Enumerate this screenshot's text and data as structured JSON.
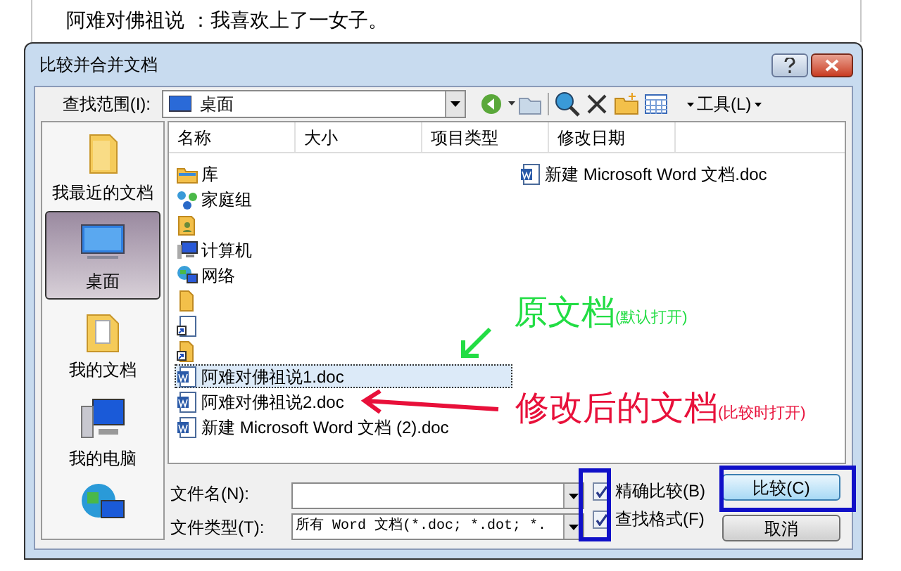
{
  "document": {
    "text": "阿难对佛祖说 ：我喜欢上了一女子。"
  },
  "window": {
    "title": "比较并合并文档"
  },
  "look_in": {
    "label": "查找范围(I):",
    "value": "桌面"
  },
  "tools_menu": {
    "label": "工具(L)"
  },
  "sidebar": {
    "items": [
      {
        "label": "我最近的文档",
        "kind": "recent",
        "selected": false
      },
      {
        "label": "桌面",
        "kind": "desktop",
        "selected": true
      },
      {
        "label": "我的文档",
        "kind": "documents",
        "selected": false
      },
      {
        "label": "我的电脑",
        "kind": "computer",
        "selected": false
      },
      {
        "kind": "network",
        "selected": false
      }
    ]
  },
  "table": {
    "columns": [
      "名称",
      "大小",
      "项目类型",
      "修改日期"
    ]
  },
  "files": [
    {
      "label": "库",
      "kind": "library",
      "selected": false
    },
    {
      "label": "家庭组",
      "kind": "homegroup",
      "selected": false
    },
    {
      "kind": "user-folder",
      "selected": false
    },
    {
      "label": "计算机",
      "kind": "computer",
      "selected": false
    },
    {
      "label": "网络",
      "kind": "network",
      "selected": false
    },
    {
      "kind": "folder",
      "selected": false
    },
    {
      "kind": "shortcut-doc",
      "selected": false
    },
    {
      "kind": "shortcut-folder",
      "selected": false
    },
    {
      "label": "阿难对佛祖说1.doc",
      "kind": "doc",
      "selected": true
    },
    {
      "label": "阿难对佛祖说2.doc",
      "kind": "doc",
      "selected": false
    },
    {
      "label": "新建 Microsoft Word 文档 (2).doc",
      "kind": "doc",
      "selected": false
    },
    {
      "label": "新建 Microsoft Word 文档.doc",
      "kind": "doc",
      "selected": false
    }
  ],
  "file_name": {
    "label": "文件名(N):"
  },
  "file_type": {
    "label": "文件类型(T):",
    "value": "所有 Word 文档(*.doc; *.dot; *."
  },
  "options": [
    {
      "label": "精确比较(B)",
      "checked": true
    },
    {
      "label": "查找格式(F)",
      "checked": true
    }
  ],
  "buttons": [
    {
      "label": "比较(C)",
      "kind": "primary"
    },
    {
      "label": "取消",
      "kind": "normal"
    }
  ],
  "annotations": [
    {
      "text": "原文档",
      "note": "(默认打开)",
      "color": "#22dd44"
    },
    {
      "text": "修改后的文档",
      "note": "(比较时打开)",
      "color": "#e8103a"
    }
  ]
}
